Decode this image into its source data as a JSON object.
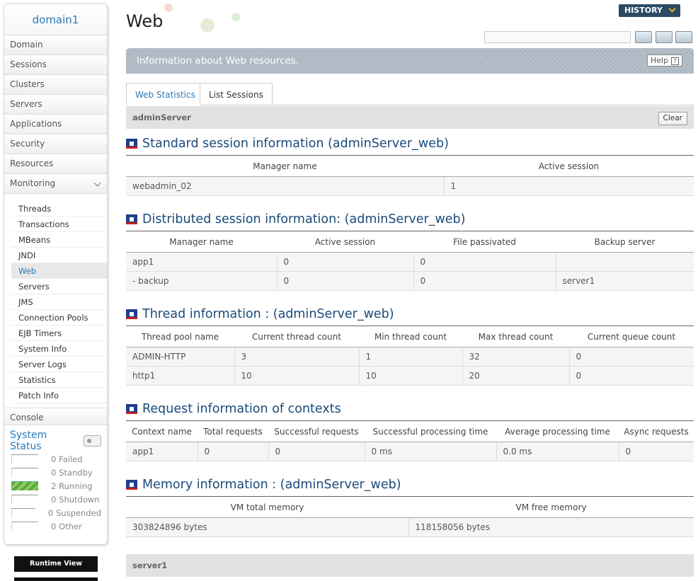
{
  "sidebar": {
    "domain": "domain1",
    "nav": [
      "Domain",
      "Sessions",
      "Clusters",
      "Servers",
      "Applications",
      "Security",
      "Resources",
      "Monitoring"
    ],
    "submenu": [
      "Threads",
      "Transactions",
      "MBeans",
      "JNDI",
      "Web",
      "Servers",
      "JMS",
      "Connection Pools",
      "EJB Timers",
      "System Info",
      "Server Logs",
      "Statistics",
      "Patch Info"
    ],
    "console": "Console",
    "status_title": "System Status",
    "status": [
      {
        "count": "0",
        "label": "Failed"
      },
      {
        "count": "0",
        "label": "Standby"
      },
      {
        "count": "2",
        "label": "Running"
      },
      {
        "count": "0",
        "label": "Shutdown"
      },
      {
        "count": "0",
        "label": "Suspended"
      },
      {
        "count": "0",
        "label": "Other"
      }
    ],
    "runtime_view": "Runtime View"
  },
  "header": {
    "title": "Web",
    "history": "HISTORY",
    "info": "Information about Web resources.",
    "help": "Help",
    "help_icon": "?"
  },
  "tabs": [
    "Web Statistics",
    "List Sessions"
  ],
  "server": {
    "name": "adminServer",
    "clear": "Clear"
  },
  "sections": {
    "standard": {
      "title": "Standard session information (adminServer_web)",
      "headers": [
        "Manager name",
        "Active session"
      ],
      "rows": [
        [
          "webadmin_02",
          "1"
        ]
      ]
    },
    "distributed": {
      "title": "Distributed session information: (adminServer_web)",
      "headers": [
        "Manager name",
        "Active session",
        "File passivated",
        "Backup server"
      ],
      "rows": [
        [
          "app1",
          "0",
          "0",
          ""
        ],
        [
          "- backup",
          "0",
          "0",
          "server1"
        ]
      ]
    },
    "thread": {
      "title": "Thread information : (adminServer_web)",
      "headers": [
        "Thread pool name",
        "Current thread count",
        "Min thread count",
        "Max thread count",
        "Current queue count"
      ],
      "rows": [
        [
          "ADMIN-HTTP",
          "3",
          "1",
          "32",
          "0"
        ],
        [
          "http1",
          "10",
          "10",
          "20",
          "0"
        ]
      ]
    },
    "request": {
      "title": "Request information of contexts",
      "headers": [
        "Context name",
        "Total requests",
        "Successful requests",
        "Successful processing time",
        "Average processing time",
        "Async requests"
      ],
      "rows": [
        [
          "app1",
          "0",
          "0",
          "0 ms",
          "0.0 ms",
          "0"
        ]
      ]
    },
    "memory": {
      "title": "Memory information : (adminServer_web)",
      "headers": [
        "VM total memory",
        "VM free memory"
      ],
      "rows": [
        [
          "303824896 bytes",
          "118158056 bytes"
        ]
      ]
    }
  },
  "server2": {
    "name": "server1"
  },
  "colors": {
    "accent": "#2a7ab8",
    "title_blue": "#1a4a7a",
    "info_bar": "#b0bbc5",
    "running": "#5da73d"
  }
}
